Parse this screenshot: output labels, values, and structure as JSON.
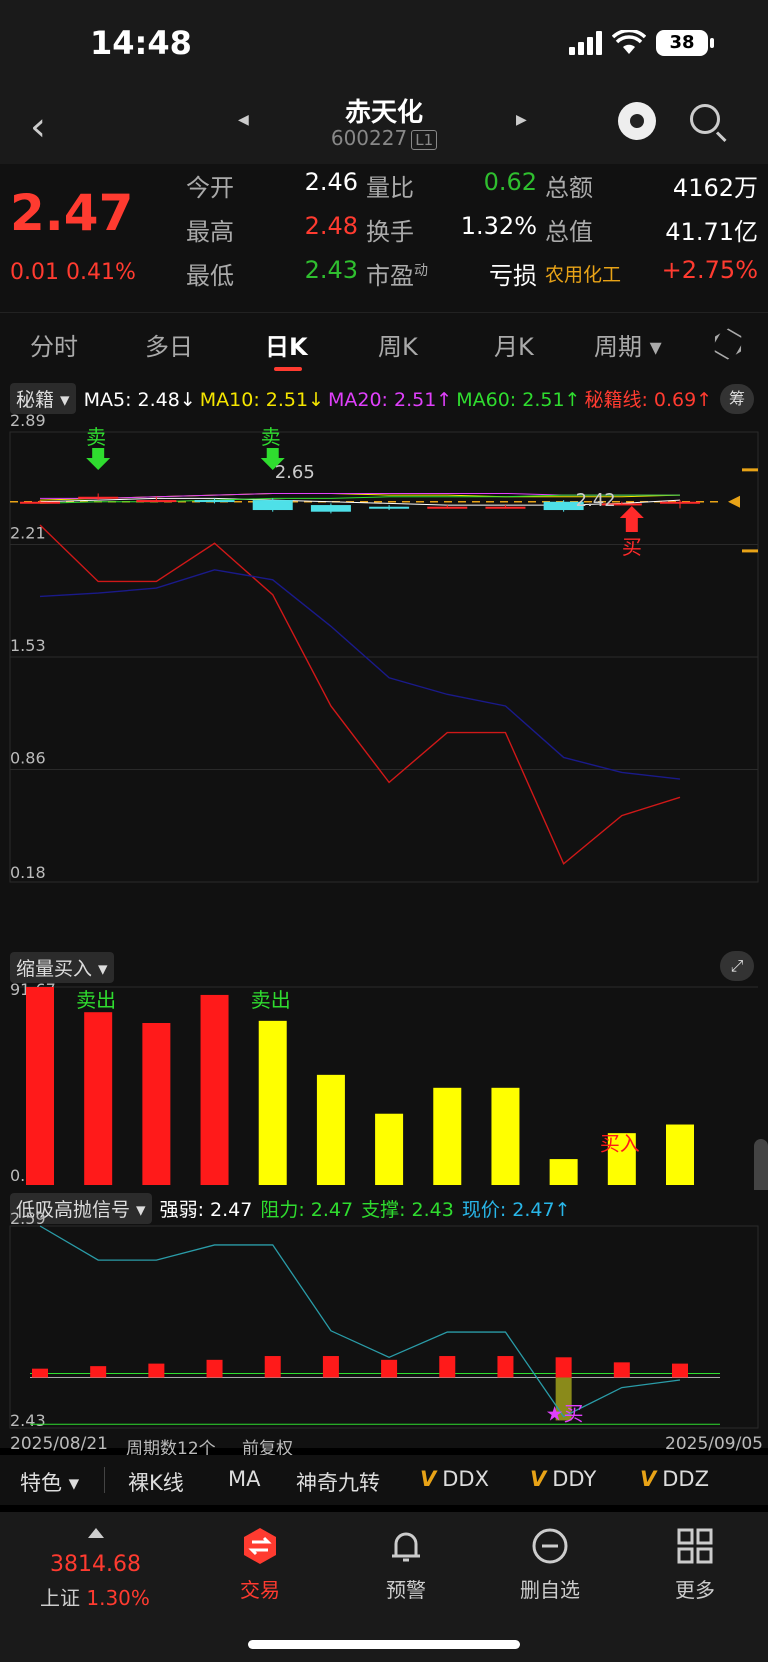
{
  "status": {
    "time": "14:48",
    "battery": "38"
  },
  "nav": {
    "title": "赤天化",
    "code": "600227",
    "level": "L1"
  },
  "quote": {
    "price": "2.47",
    "change": "0.01",
    "change_pct": "0.41%",
    "rows": [
      [
        {
          "label": "今开",
          "value": "2.46",
          "color": "#ffffff"
        },
        {
          "label": "量比",
          "value": "0.62",
          "color": "#2fbf2f"
        },
        {
          "label": "总额",
          "value": "4162万",
          "color": "#ffffff"
        }
      ],
      [
        {
          "label": "最高",
          "value": "2.48",
          "color": "#ff3b30"
        },
        {
          "label": "换手",
          "value": "1.32%",
          "color": "#ffffff"
        },
        {
          "label": "总值",
          "value": "41.71亿",
          "color": "#ffffff"
        }
      ],
      [
        {
          "label": "最低",
          "value": "2.43",
          "color": "#2fbf2f"
        },
        {
          "label": "市盈",
          "sup": "动",
          "value": "亏损",
          "color": "#ffffff"
        },
        {
          "label": "农用化工",
          "value": "+2.75%",
          "color": "#ff3b30"
        }
      ]
    ]
  },
  "tabs": [
    "分时",
    "多日",
    "日K",
    "周K",
    "月K",
    "周期"
  ],
  "active_tab": "日K",
  "main_indicator": {
    "selector": "秘籍",
    "items": [
      {
        "text": "MA5: 2.48↓",
        "color": "#ffffff"
      },
      {
        "text": "MA10: 2.51↓",
        "color": "#f5e500"
      },
      {
        "text": "MA20: 2.51↑",
        "color": "#e040fb"
      },
      {
        "text": "MA60: 2.51↑",
        "color": "#2fdc2f"
      },
      {
        "text": "秘籍线: 0.69↑",
        "color": "#ff3b30"
      }
    ],
    "chip_button": "筹",
    "axis": [
      "2.89",
      "2.21",
      "1.53",
      "0.86",
      "0.18"
    ],
    "annotations": {
      "sell1": "卖",
      "sell2": "卖",
      "buy": "买",
      "high": "2.65",
      "low": "2.42"
    }
  },
  "chart_data": [
    {
      "type": "line",
      "x": [
        1,
        2,
        3,
        4,
        5,
        6,
        7,
        8,
        9,
        10,
        11,
        12
      ],
      "ylim": [
        0.18,
        2.89
      ],
      "series": [
        {
          "name": "",
          "color": "#d01818",
          "values": [
            2.33,
            1.99,
            1.99,
            2.22,
            1.91,
            1.24,
            0.78,
            1.08,
            1.08,
            0.29,
            0.58,
            0.69
          ]
        },
        {
          "name": "",
          "color": "#1a1a8a",
          "values": [
            1.9,
            1.92,
            1.95,
            2.06,
            2.0,
            1.72,
            1.41,
            1.31,
            1.24,
            0.93,
            0.84,
            0.8
          ]
        }
      ],
      "candles": {
        "open": [
          2.47,
          2.49,
          2.48,
          2.48,
          2.48,
          2.45,
          2.44,
          2.43,
          2.44,
          2.47,
          2.46,
          2.46
        ],
        "close": [
          2.47,
          2.5,
          2.48,
          2.47,
          2.42,
          2.41,
          2.43,
          2.44,
          2.44,
          2.42,
          2.46,
          2.47
        ],
        "high": [
          2.48,
          2.52,
          2.5,
          2.49,
          2.49,
          2.46,
          2.45,
          2.45,
          2.45,
          2.48,
          2.47,
          2.48
        ],
        "low": [
          2.46,
          2.48,
          2.47,
          2.46,
          2.41,
          2.4,
          2.42,
          2.43,
          2.43,
          2.41,
          2.45,
          2.43
        ]
      }
    },
    {
      "type": "bar",
      "title": "缩量买入",
      "x": [
        1,
        2,
        3,
        4,
        5,
        6,
        7,
        8,
        9,
        10,
        11,
        12
      ],
      "values": [
        91.67,
        80,
        75,
        88,
        76,
        51,
        33,
        45,
        45,
        12,
        24,
        28
      ],
      "colors": [
        "#ff1a1a",
        "#ff1a1a",
        "#ff1a1a",
        "#ff1a1a",
        "#ffff00",
        "#ffff00",
        "#ffff00",
        "#ffff00",
        "#ffff00",
        "#ffff00",
        "#ffff00",
        "#ffff00"
      ],
      "ylim": [
        0,
        91.67
      ],
      "axis": [
        "91.67",
        "0.00"
      ],
      "labels": [
        {
          "i": 2,
          "text": "卖出",
          "color": "#2fdc2f"
        },
        {
          "i": 5,
          "text": "卖出",
          "color": "#2fdc2f"
        },
        {
          "i": 11,
          "text": "买入",
          "color": "#ff1a1a"
        }
      ]
    },
    {
      "type": "bar",
      "title": "低吸高抛信号",
      "x": [
        1,
        2,
        3,
        4,
        5,
        6,
        7,
        8,
        9,
        10,
        11,
        12
      ],
      "values": [
        2.477,
        2.479,
        2.481,
        2.484,
        2.487,
        2.487,
        2.484,
        2.487,
        2.487,
        2.486,
        2.482,
        2.481
      ],
      "base": 2.47,
      "line": [
        2.59,
        2.563,
        2.563,
        2.575,
        2.575,
        2.507,
        2.486,
        2.506,
        2.506,
        2.439,
        2.462,
        2.468
      ],
      "ylim": [
        2.43,
        2.59
      ],
      "axis": [
        "2.59",
        "2.43"
      ],
      "levels": {
        "resistance": 2.47,
        "support": 2.433
      }
    }
  ],
  "volume": {
    "selector": "缩量买入"
  },
  "signal": {
    "selector": "低吸高抛信号",
    "items": [
      {
        "text": "强弱: 2.47",
        "color": "#ffffff"
      },
      {
        "text": "阻力: 2.47",
        "color": "#2fdc2f"
      },
      {
        "text": "支撑: 2.43",
        "color": "#2fdc2f"
      },
      {
        "text": "现价: 2.47↑",
        "color": "#29b6e8"
      }
    ],
    "buy_mark": "★买",
    "date_start": "2025/08/21",
    "period_count": "周期数12个",
    "adjust": "前复权",
    "date_end": "2025/09/05"
  },
  "indicator_bar": {
    "items": [
      {
        "label": "特色 ▾",
        "v": false
      },
      {
        "label": "裸K线",
        "v": false
      },
      {
        "label": "MA",
        "v": false
      },
      {
        "label": "神奇九转",
        "v": false
      },
      {
        "label": "DDX",
        "v": true
      },
      {
        "label": "DDY",
        "v": true
      },
      {
        "label": "DDZ",
        "v": true
      }
    ]
  },
  "bottom_nav": {
    "index_value": "3814.68",
    "index_name": "上证",
    "index_pct": "1.30%",
    "items": [
      "交易",
      "预警",
      "删自选",
      "更多"
    ]
  },
  "colors": {
    "up": "#ff3b30",
    "down": "#2fbf2f",
    "accent": "#e8a317"
  }
}
